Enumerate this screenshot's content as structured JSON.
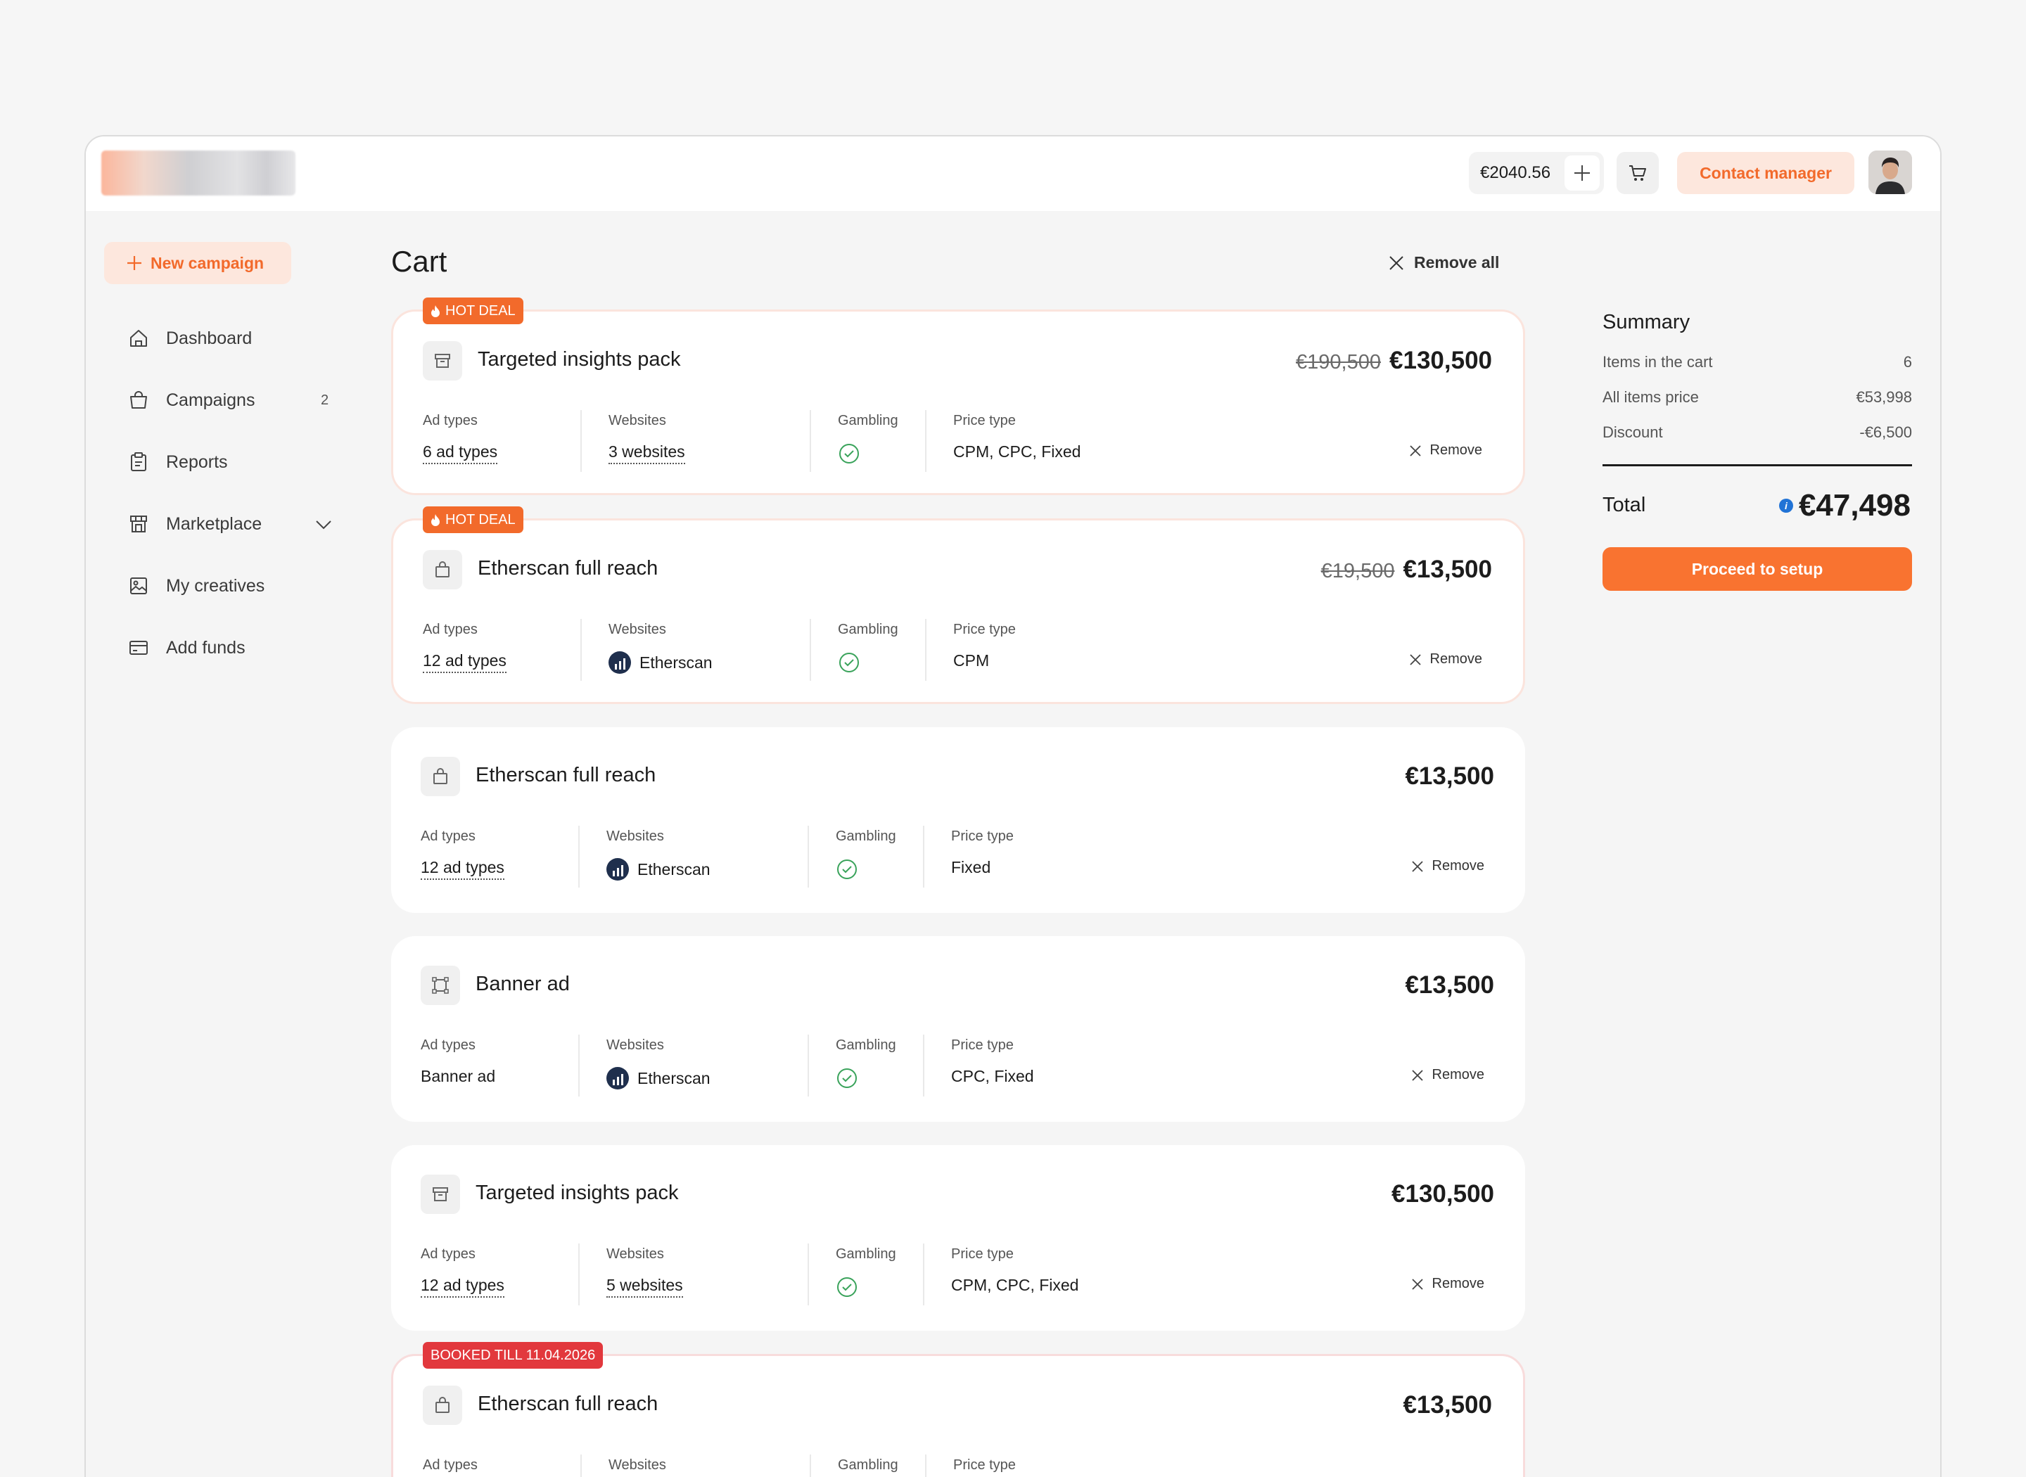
{
  "header": {
    "balance": "€2040.56",
    "contact_label": "Contact manager"
  },
  "sidebar": {
    "new_campaign_label": "New campaign",
    "items": [
      {
        "label": "Dashboard",
        "icon": "home-icon"
      },
      {
        "label": "Campaigns",
        "icon": "shopping-bag-icon",
        "badge": "2"
      },
      {
        "label": "Reports",
        "icon": "clipboard-icon"
      },
      {
        "label": "Marketplace",
        "icon": "store-icon"
      },
      {
        "label": "My creatives",
        "icon": "image-icon"
      },
      {
        "label": "Add funds",
        "icon": "credit-card-icon"
      }
    ]
  },
  "cart": {
    "title": "Cart",
    "remove_all_label": "Remove all",
    "column_labels": {
      "ad_types": "Ad types",
      "websites": "Websites",
      "gambling": "Gambling",
      "price_type": "Price type"
    },
    "remove_label": "Remove",
    "items": [
      {
        "tag": "HOT DEAL",
        "title": "Targeted insights pack",
        "old_price": "€190,500",
        "price": "€130,500",
        "ad_types": "6 ad types",
        "websites": "3 websites",
        "price_type": "CPM, CPC, Fixed"
      },
      {
        "tag": "HOT DEAL",
        "title": "Etherscan full reach",
        "old_price": "€19,500",
        "price": "€13,500",
        "ad_types": "12 ad types",
        "websites": "Etherscan",
        "price_type": "CPM"
      },
      {
        "title": "Etherscan full reach",
        "price": "€13,500",
        "ad_types": "12 ad types",
        "websites": "Etherscan",
        "price_type": "Fixed"
      },
      {
        "title": "Banner ad",
        "price": "€13,500",
        "ad_types": "Banner ad",
        "websites": "Etherscan",
        "price_type": "CPC, Fixed"
      },
      {
        "title": "Targeted insights pack",
        "price": "€130,500",
        "ad_types": "12 ad types",
        "websites": "5 websites",
        "price_type": "CPM, CPC, Fixed"
      },
      {
        "tag": "BOOKED TILL 11.04.2026",
        "title": "Etherscan full reach",
        "price": "€13,500"
      }
    ]
  },
  "summary": {
    "title": "Summary",
    "rows": [
      {
        "label": "Items in the cart",
        "value": "6"
      },
      {
        "label": "All items price",
        "value": "€53,998"
      },
      {
        "label": "Discount",
        "value": "-€6,500"
      }
    ],
    "total_label": "Total",
    "total_value": "€47,498",
    "proceed_label": "Proceed to setup"
  },
  "colors": {
    "accent": "#f97330",
    "accent_soft": "#fde7dd",
    "booked": "#e2383d",
    "success": "#3aa35b"
  }
}
